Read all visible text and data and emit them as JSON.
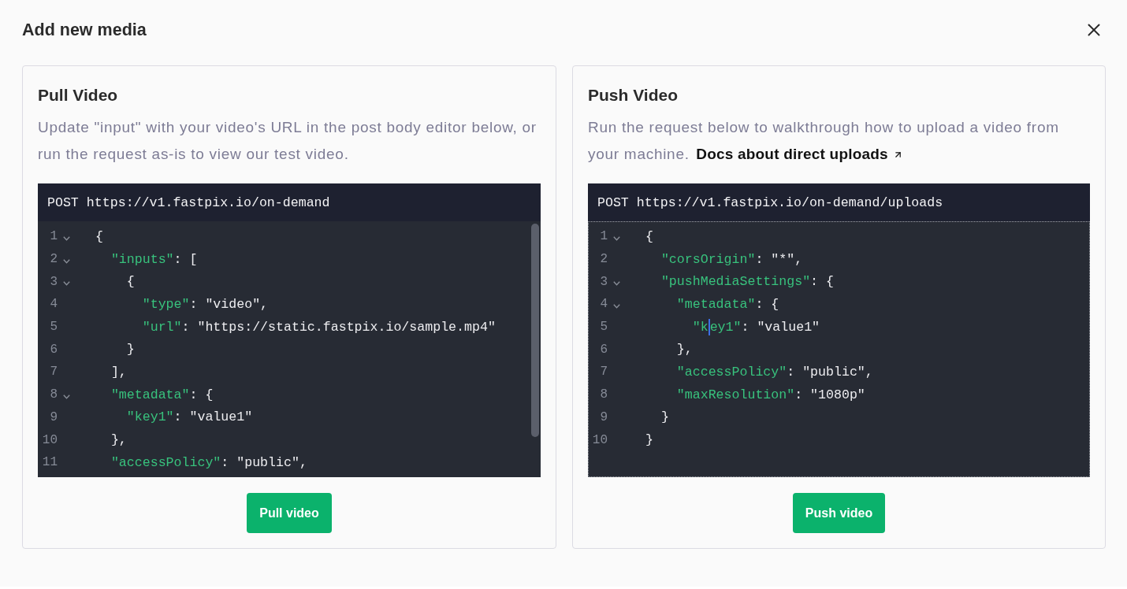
{
  "dialog": {
    "title": "Add new media"
  },
  "cards": [
    {
      "title": "Pull Video",
      "description": "Update \"input\" with your video's URL in the post body editor below, or run the request as-is to view our test video.",
      "editor": {
        "method": "POST",
        "url": "https://v1.fastpix.io/on-demand",
        "focused": false,
        "scrollbar": true,
        "lines": [
          {
            "number": "1",
            "foldable": true,
            "tokens": [
              {
                "kind": "plain",
                "text": "{"
              }
            ]
          },
          {
            "number": "2",
            "foldable": true,
            "tokens": [
              {
                "kind": "key",
                "text": "  \"inputs\""
              },
              {
                "kind": "plain",
                "text": ": ["
              }
            ]
          },
          {
            "number": "3",
            "foldable": true,
            "tokens": [
              {
                "kind": "plain",
                "text": "    {"
              }
            ]
          },
          {
            "number": "4",
            "foldable": false,
            "tokens": [
              {
                "kind": "key",
                "text": "      \"type\""
              },
              {
                "kind": "plain",
                "text": ": \"video\","
              }
            ]
          },
          {
            "number": "5",
            "foldable": false,
            "tokens": [
              {
                "kind": "key",
                "text": "      \"url\""
              },
              {
                "kind": "plain",
                "text": ": \"https://static.fastpix.io/sample.mp4\""
              }
            ]
          },
          {
            "number": "6",
            "foldable": false,
            "tokens": [
              {
                "kind": "plain",
                "text": "    }"
              }
            ]
          },
          {
            "number": "7",
            "foldable": false,
            "tokens": [
              {
                "kind": "plain",
                "text": "  ],"
              }
            ]
          },
          {
            "number": "8",
            "foldable": true,
            "tokens": [
              {
                "kind": "key",
                "text": "  \"metadata\""
              },
              {
                "kind": "plain",
                "text": ": {"
              }
            ]
          },
          {
            "number": "9",
            "foldable": false,
            "tokens": [
              {
                "kind": "key",
                "text": "    \"key1\""
              },
              {
                "kind": "plain",
                "text": ": \"value1\""
              }
            ]
          },
          {
            "number": "10",
            "foldable": false,
            "tokens": [
              {
                "kind": "plain",
                "text": "  },"
              }
            ]
          },
          {
            "number": "11",
            "foldable": false,
            "tokens": [
              {
                "kind": "key",
                "text": "  \"accessPolicy\""
              },
              {
                "kind": "plain",
                "text": ": \"public\","
              }
            ]
          }
        ]
      },
      "button": "Pull video"
    },
    {
      "title": "Push Video",
      "description": "Run the request below to walkthrough how to upload a video from your machine.",
      "link": "Docs about direct uploads",
      "editor": {
        "method": "POST",
        "url": "https://v1.fastpix.io/on-demand/uploads",
        "focused": true,
        "scrollbar": false,
        "lines": [
          {
            "number": "1",
            "foldable": true,
            "tokens": [
              {
                "kind": "plain",
                "text": "{"
              }
            ]
          },
          {
            "number": "2",
            "foldable": false,
            "tokens": [
              {
                "kind": "key",
                "text": "  \"corsOrigin\""
              },
              {
                "kind": "plain",
                "text": ": \"*\","
              }
            ]
          },
          {
            "number": "3",
            "foldable": true,
            "tokens": [
              {
                "kind": "key",
                "text": "  \"pushMediaSettings\""
              },
              {
                "kind": "plain",
                "text": ": {"
              }
            ]
          },
          {
            "number": "4",
            "foldable": true,
            "tokens": [
              {
                "kind": "key",
                "text": "    \"metadata\""
              },
              {
                "kind": "plain",
                "text": ": {"
              }
            ]
          },
          {
            "number": "5",
            "foldable": false,
            "tokens": [
              {
                "kind": "key",
                "text": "      \"k"
              },
              {
                "kind": "cursor"
              },
              {
                "kind": "key",
                "text": "ey1\""
              },
              {
                "kind": "plain",
                "text": ": \"value1\""
              }
            ]
          },
          {
            "number": "6",
            "foldable": false,
            "tokens": [
              {
                "kind": "plain",
                "text": "    },"
              }
            ]
          },
          {
            "number": "7",
            "foldable": false,
            "tokens": [
              {
                "kind": "key",
                "text": "    \"accessPolicy\""
              },
              {
                "kind": "plain",
                "text": ": \"public\","
              }
            ]
          },
          {
            "number": "8",
            "foldable": false,
            "tokens": [
              {
                "kind": "key",
                "text": "    \"maxResolution\""
              },
              {
                "kind": "plain",
                "text": ": \"1080p\""
              }
            ]
          },
          {
            "number": "9",
            "foldable": false,
            "tokens": [
              {
                "kind": "plain",
                "text": "  }"
              }
            ]
          },
          {
            "number": "10",
            "foldable": false,
            "tokens": [
              {
                "kind": "plain",
                "text": "}"
              }
            ]
          }
        ]
      },
      "button": "Push video"
    }
  ]
}
